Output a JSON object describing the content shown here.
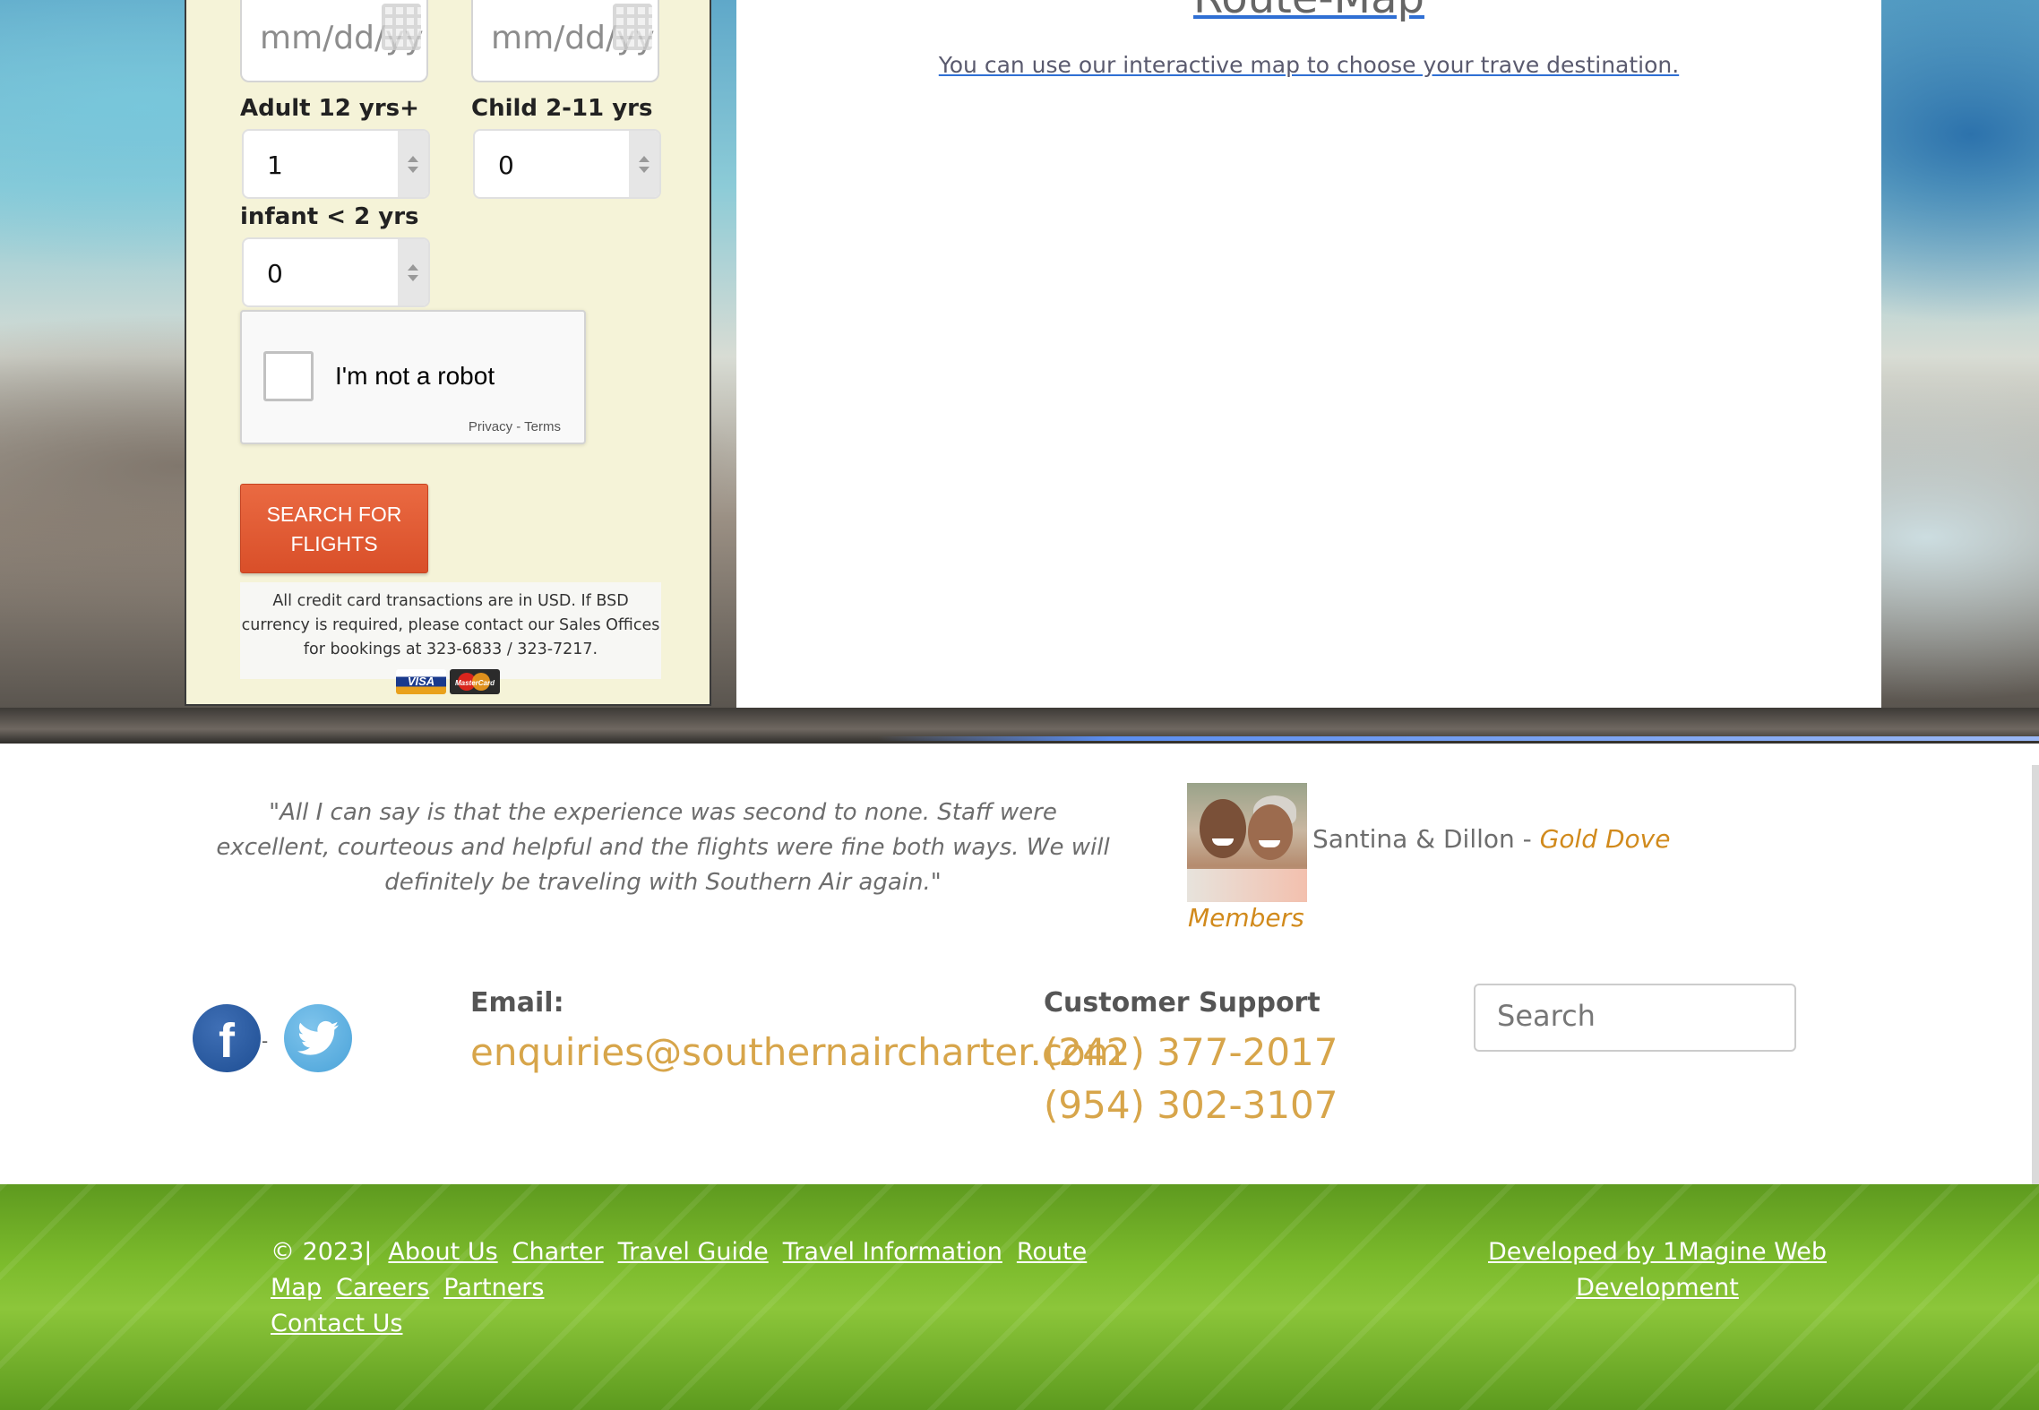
{
  "booking": {
    "depart_date_placeholder": "mm/dd/yy",
    "return_date_placeholder": "mm/dd/yy",
    "adult_label": "Adult 12 yrs+",
    "adult_value": "1",
    "child_label": "Child 2-11 yrs",
    "child_value": "0",
    "infant_label": "infant < 2 yrs",
    "infant_value": "0",
    "captcha_label": "I'm not a robot",
    "captcha_links": "Privacy - Terms",
    "search_button_line1": "SEARCH FOR",
    "search_button_line2": "FLIGHTS",
    "cc_note": "All credit card transactions are in USD. If BSD currency is required, please contact our Sales Offices for bookings at 323-6833 / 323-7217.",
    "card_visa": "VISA",
    "card_mastercard": "MasterCard"
  },
  "map": {
    "title": "Route-Map",
    "subtitle": "You can use our interactive map to choose your trave destination."
  },
  "testimonial": {
    "quote": "\"All I can say is that the experience was second to none. Staff were excellent, courteous and helpful and the flights were fine both ways. We will definitely be traveling with Southern Air again.\"",
    "author": "Santina & Dillon - ",
    "tier": "Gold Dove",
    "tier_suffix": "Members"
  },
  "contact": {
    "email_label": "Email:",
    "email_value": "enquiries@southernaircharter.com",
    "support_label": "Customer Support",
    "phone1": "(242) 377-2017",
    "phone2": "(954) 302-3107",
    "search_placeholder": "Search",
    "social_separator": "-"
  },
  "footer": {
    "copyright": "© 2023|",
    "links": [
      "About Us",
      "Charter",
      "Travel Guide",
      "Travel Information",
      "Route Map",
      "Careers",
      "Partners",
      "Contact Us"
    ],
    "developer": "Developed by 1Magine Web Development"
  },
  "colors": {
    "accent_gold": "#d7a54a",
    "tier_orange": "#d18a1c",
    "button_orange": "#e2592f",
    "footer_green": "#7cbb2c",
    "panel_cream": "#f5f3d8"
  }
}
